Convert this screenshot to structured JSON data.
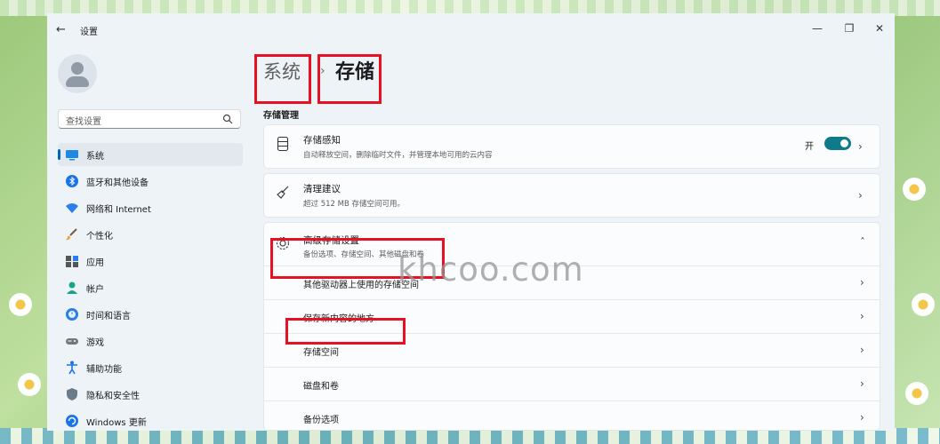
{
  "window": {
    "app_title": "设置",
    "controls": {
      "minimize": "—",
      "maximize": "❐",
      "close": "✕"
    }
  },
  "sidebar": {
    "search_placeholder": "查找设置",
    "items": [
      {
        "label": "系统",
        "icon": "monitor-icon",
        "active": true
      },
      {
        "label": "蓝牙和其他设备",
        "icon": "bluetooth-icon"
      },
      {
        "label": "网络和 Internet",
        "icon": "wifi-icon"
      },
      {
        "label": "个性化",
        "icon": "brush-icon"
      },
      {
        "label": "应用",
        "icon": "apps-icon"
      },
      {
        "label": "帐户",
        "icon": "person-icon"
      },
      {
        "label": "时间和语言",
        "icon": "globe-clock-icon"
      },
      {
        "label": "游戏",
        "icon": "gamepad-icon"
      },
      {
        "label": "辅助功能",
        "icon": "accessibility-icon"
      },
      {
        "label": "隐私和安全性",
        "icon": "shield-icon"
      },
      {
        "label": "Windows 更新",
        "icon": "update-icon"
      }
    ]
  },
  "breadcrumb": {
    "parent": "系统",
    "separator": "›",
    "current": "存储"
  },
  "section": {
    "title": "存储管理"
  },
  "cards": {
    "storage_sense": {
      "title": "存储感知",
      "desc": "自动释放空间，删除临时文件，并管理本地可用的云内容",
      "toggle_label": "开",
      "toggle_on": true
    },
    "cleanup": {
      "title": "清理建议",
      "desc": "超过 512 MB 存储空间可用。"
    },
    "advanced": {
      "title": "高级存储设置",
      "desc": "备份选项、存储空间、其他磁盘和卷",
      "expanded": true
    }
  },
  "sub_items": [
    {
      "label": "其他驱动器上使用的存储空间"
    },
    {
      "label": "保存新内容的地方"
    },
    {
      "label": "存储空间"
    },
    {
      "label": "磁盘和卷"
    },
    {
      "label": "备份选项"
    }
  ],
  "watermark": "khcoo.com",
  "colors": {
    "accent": "#0067c0",
    "toggle": "#0f7a8a",
    "highlight": "#e81123"
  }
}
